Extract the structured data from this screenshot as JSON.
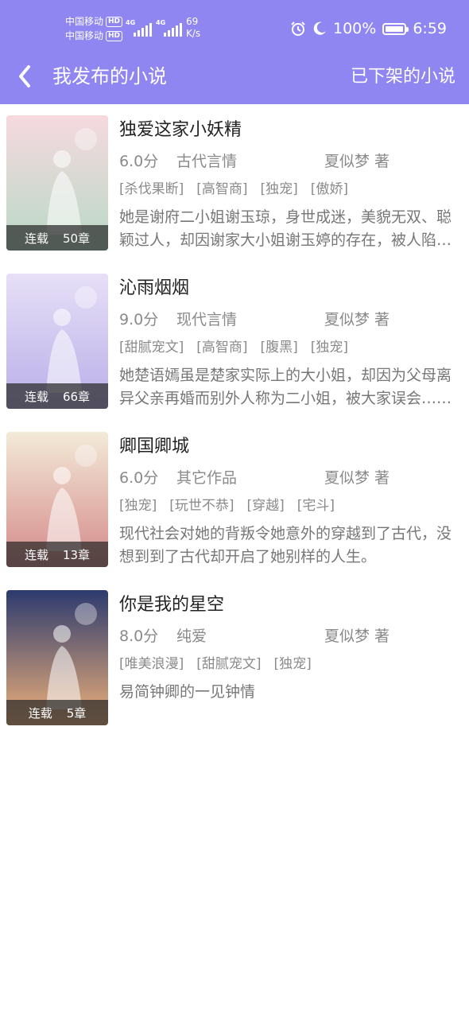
{
  "status_bar": {
    "carrier_1": "中国移动",
    "carrier_2": "中国移动",
    "hd_badge": "HD",
    "network_1": "4G",
    "network_2": "4G",
    "speed_value": "69",
    "speed_unit": "K/s",
    "battery_text": "100%",
    "battery_level": 1.0,
    "time": "6:59"
  },
  "header": {
    "title": "我发布的小说",
    "right_link": "已下架的小说"
  },
  "books": [
    {
      "title": "独爱这家小妖精",
      "score": "6.0分",
      "genre": "古代言情",
      "author": "夏似梦 著",
      "tags": [
        "[杀伐果断]",
        "[高智商]",
        "[独宠]",
        "[傲娇]"
      ],
      "description": "她是谢府二小姐谢玉琼，身世成迷，美貌无双、聪颖过人，却因谢家大小姐谢玉婷的存在，被人陷害……",
      "status": "连载",
      "chapters": "50章",
      "cover_colors": [
        "#f6d9df",
        "#b8d9c6"
      ]
    },
    {
      "title": "沁雨烟烟",
      "score": "9.0分",
      "genre": "现代言情",
      "author": "夏似梦 著",
      "tags": [
        "[甜腻宠文]",
        "[高智商]",
        "[腹黑]",
        "[独宠]"
      ],
      "description": "她楚语嫣虽是楚家实际上的大小姐，却因为父母离异父亲再婚而别外人称为二小姐，被大家误会……",
      "status": "连载",
      "chapters": "66章",
      "cover_colors": [
        "#e7e0f7",
        "#b9aee8"
      ]
    },
    {
      "title": "卿国卿城",
      "score": "6.0分",
      "genre": "其它作品",
      "author": "夏似梦 著",
      "tags": [
        "[独宠]",
        "[玩世不恭]",
        "[穿越]",
        "[宅斗]"
      ],
      "description": "现代社会对她的背叛令她意外的穿越到了古代，没想到到了古代却开启了她别样的人生。",
      "status": "连载",
      "chapters": "13章",
      "cover_colors": [
        "#f3ead8",
        "#d48a8a"
      ]
    },
    {
      "title": "你是我的星空",
      "score": "8.0分",
      "genre": "纯爱",
      "author": "夏似梦 著",
      "tags": [
        "[唯美浪漫]",
        "[甜腻宠文]",
        "[独宠]"
      ],
      "description": "易简钟卿的一见钟情",
      "status": "连载",
      "chapters": "5章",
      "cover_colors": [
        "#2c3a6e",
        "#f0b27a"
      ]
    }
  ]
}
